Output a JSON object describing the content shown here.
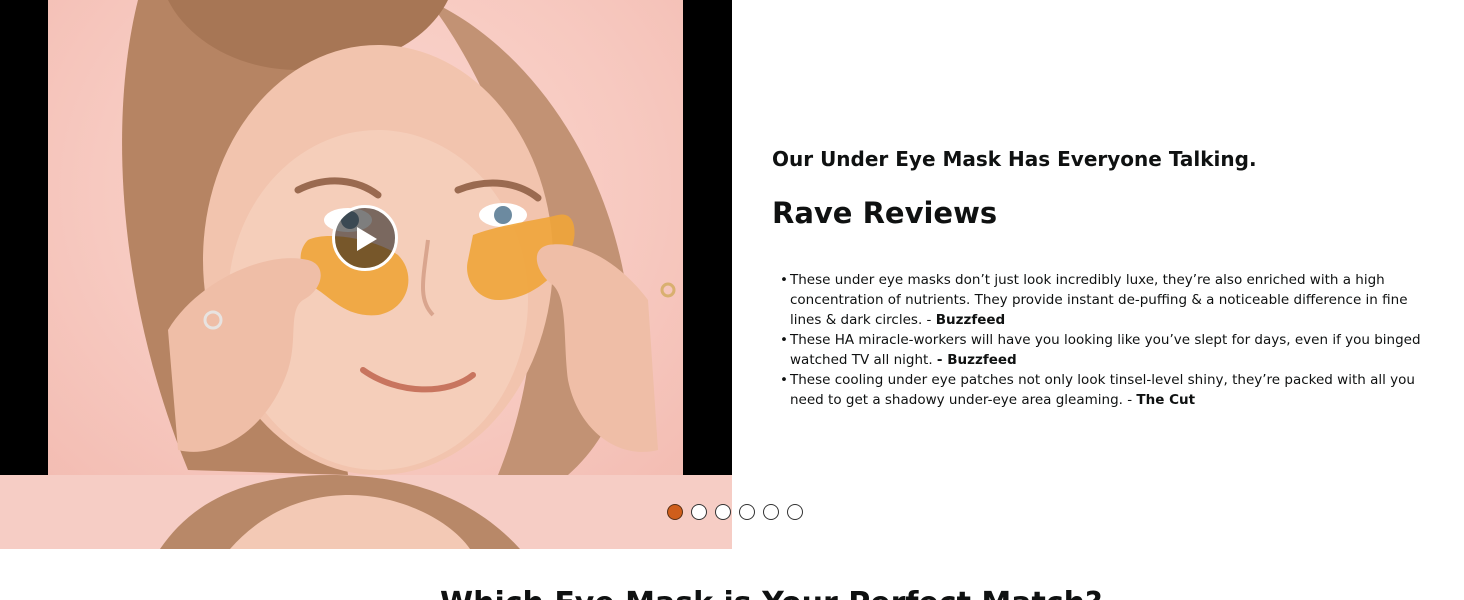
{
  "media": {
    "icon": "play-icon",
    "background_color": "#000000",
    "skin_tone": "#f6cdc5"
  },
  "section": {
    "subheading": "Our Under Eye Mask Has Everyone Talking.",
    "heading": "Rave Reviews"
  },
  "reviews": [
    {
      "text": "These under eye masks don’t just look incredibly luxe, they’re also enriched with a high concentration of nutrients. They provide instant de-puffing & a noticeable difference in fine lines & dark circles. - ",
      "source": "Buzzfeed"
    },
    {
      "text": "These HA miracle-workers will have you looking like you’ve slept for days, even if you binged watched TV all night. ",
      "source": "- Buzzfeed"
    },
    {
      "text": "These cooling under eye patches not only look tinsel-level shiny, they’re packed with all you need to get a shadowy under-eye area gleaming. - ",
      "source": "The Cut"
    }
  ],
  "carousel": {
    "total_slides": 6,
    "active_index": 0,
    "active_color": "#cf5e1b"
  },
  "next_section": {
    "heading": "Which Eye Mask is Your Perfect Match?"
  }
}
